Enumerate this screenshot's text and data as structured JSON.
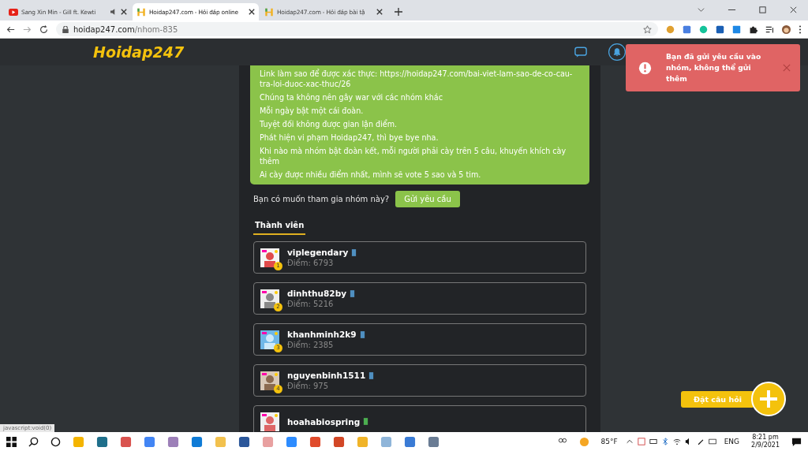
{
  "browser_tabs": [
    {
      "title": "Sang Xin Min - Gill ft. Kewti",
      "kind": "video",
      "audio": true,
      "selected": false
    },
    {
      "title": "Hoidap247.com - Hỏi đáp online",
      "kind": "site",
      "audio": false,
      "selected": true
    },
    {
      "title": "Hoidap247.com - Hỏi đáp bài tậ",
      "kind": "site",
      "audio": false,
      "selected": false
    }
  ],
  "address_bar": {
    "host": "hoidap247.com",
    "path": "/nhom-835"
  },
  "header": {
    "logo": "Hoidap247"
  },
  "rules": [
    "Link làm sao để được xác thực: https://hoidap247.com/bai-viet-lam-sao-de-co-cau-tra-loi-duoc-xac-thuc/26",
    "Chúng ta không nên gây war với các nhóm khác",
    "Mỗi ngày bật một cái đoàn.",
    "Tuyệt đối không được gian lận điểm.",
    "Phát hiện vi phạm Hoidap247, thì bye bye nha.",
    "Khi nào mà nhóm bật đoàn kết, mỗi người phải cày trên 5 câu, khuyến khích cày thêm",
    "Ai cày được nhiều điểm nhất, mình sẽ vote 5 sao và 5 tim."
  ],
  "join": {
    "question": "Bạn có muốn tham gia nhóm này?",
    "button": "Gửi yêu cầu"
  },
  "section_tabs": [
    {
      "label": "Thành viên",
      "selected": true
    }
  ],
  "members": [
    {
      "name": "viplegendary",
      "points": "Điểm: 6793",
      "rank": "1",
      "color": "#4f8fc0"
    },
    {
      "name": "dinhthu82by",
      "points": "Điểm: 5216",
      "rank": "2",
      "color": "#4f8fc0"
    },
    {
      "name": "khanhminh2k9",
      "points": "Điểm: 2385",
      "rank": "3",
      "color": "#4f8fc0"
    },
    {
      "name": "nguyenbinh1511",
      "points": "Điểm: 975",
      "rank": "4",
      "color": "#4f8fc0"
    },
    {
      "name": "hoahabiospring",
      "color": "#4caf50"
    }
  ],
  "toast": {
    "message": "Bạn đã gửi yêu cầu vào nhóm, không thể gửi thêm"
  },
  "ask_button": {
    "label": "Đặt câu hỏi"
  },
  "status_text": "javascript:void(0)",
  "taskbar": {
    "weather": "85°F",
    "language": "ENG",
    "time": "8:21 pm",
    "date": "2/9/2021"
  }
}
